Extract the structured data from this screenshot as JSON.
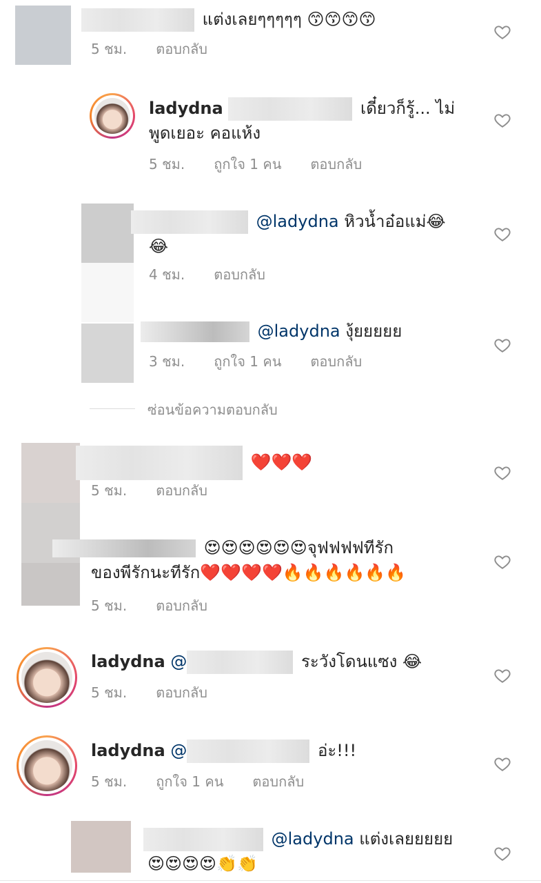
{
  "comments": [
    {
      "text": "แต่งเลยๆๆๆๆๆ",
      "emoji": "😙😙😙😙",
      "time": "5 ชม.",
      "reply": "ตอบกลับ"
    },
    {
      "username": "ladydna",
      "text": "เดี๋ยวก็รู้... ไม่พูดเยอะ คอแห้ง",
      "text_line1": "เดี๋ยวก็รู้... ไม่",
      "text_line2": "พูดเยอะ คอแห้ง",
      "time": "5 ชม.",
      "likes": "ถูกใจ 1 คน",
      "reply": "ตอบกลับ"
    },
    {
      "mention": "@ladydna",
      "text": "หิวน้ำอ๋อแม่",
      "emoji1": "😂",
      "emoji2": "😂",
      "time": "4 ชม.",
      "reply": "ตอบกลับ"
    },
    {
      "mention": "@ladydna",
      "text": "งุ้ยยยยย",
      "time": "3 ชม.",
      "likes": "ถูกใจ 1 คน",
      "reply": "ตอบกลับ"
    },
    {
      "emoji": "❤️❤️❤️",
      "time": "5 ชม.",
      "reply": "ตอบกลับ"
    },
    {
      "emoji1": "😍😍😍😍😍😍",
      "text1": "จุฟฟฟฟทีรัก",
      "text2": "ของพีรักนะทีรัก",
      "emoji2": "❤️❤️❤️❤️🔥🔥🔥🔥🔥🔥",
      "time": "5 ชม.",
      "reply": "ตอบกลับ"
    },
    {
      "username": "ladydna",
      "mention": "@",
      "text": "ระวังโดนแซง",
      "emoji": "😂",
      "time": "5 ชม.",
      "reply": "ตอบกลับ"
    },
    {
      "username": "ladydna",
      "mention": "@",
      "text": "อ่ะ!!!",
      "time": "5 ชม.",
      "likes": "ถูกใจ 1 คน",
      "reply": "ตอบกลับ"
    },
    {
      "mention": "@ladydna",
      "text": "แต่งเลยยยยย",
      "emoji": "😍😍😍😍👏👏"
    }
  ],
  "hide_replies": "ซ่อนข้อความตอบกลับ",
  "colors": {
    "text": "#262626",
    "meta": "#8e8e8e",
    "mention": "#003569",
    "heart_outline": "#8e8e8e"
  },
  "icons": {
    "like": "heart-outline-icon"
  }
}
